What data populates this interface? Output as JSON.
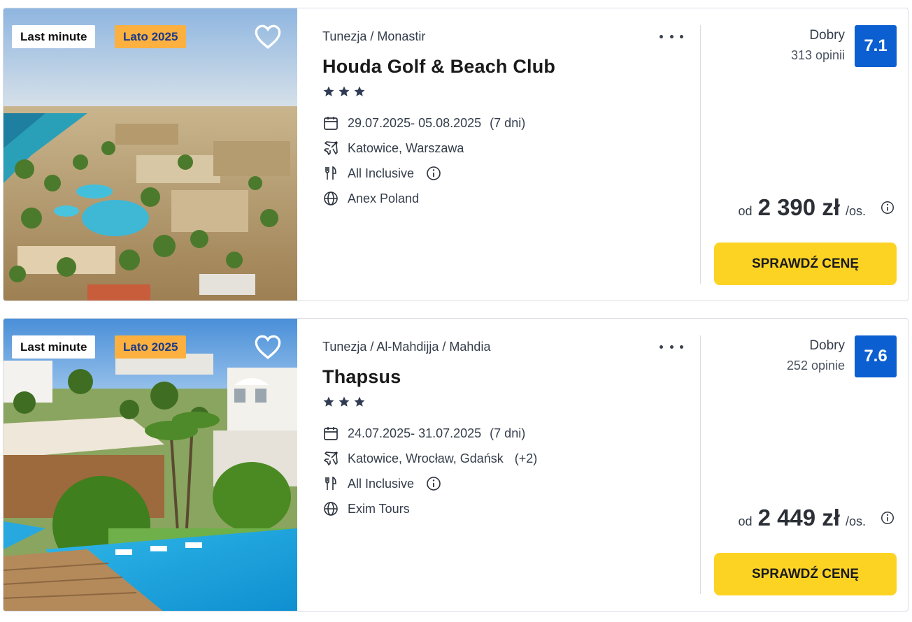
{
  "offers": [
    {
      "badges": {
        "last_minute": "Last minute",
        "season": "Lato 2025"
      },
      "location": "Tunezja / Monastir",
      "name": "Houda Golf & Beach Club",
      "stars": 3,
      "dates": "29.07.2025- 05.08.2025",
      "duration": "(7 dni)",
      "departures": "Katowice, Warszawa",
      "departures_extra": "",
      "board": "All Inclusive",
      "operator": "Anex Poland",
      "rating_label": "Dobry",
      "rating_count": "313 opinii",
      "rating_score": "7.1",
      "price_from": "od",
      "price": "2 390 zł",
      "price_unit": "/os.",
      "cta": "SPRAWDŹ CENĘ"
    },
    {
      "badges": {
        "last_minute": "Last minute",
        "season": "Lato 2025"
      },
      "location": "Tunezja / Al-Mahdijja / Mahdia",
      "name": "Thapsus",
      "stars": 3,
      "dates": "24.07.2025- 31.07.2025",
      "duration": "(7 dni)",
      "departures": "Katowice, Wrocław, Gdańsk",
      "departures_extra": "(+2)",
      "board": "All Inclusive",
      "operator": "Exim Tours",
      "rating_label": "Dobry",
      "rating_count": "252 opinie",
      "rating_score": "7.6",
      "price_from": "od",
      "price": "2 449 zł",
      "price_unit": "/os.",
      "cta": "SPRAWDŹ CENĘ"
    }
  ],
  "icons": {
    "favorite": "heart-outline-icon",
    "more": "more-horizontal-icon",
    "star": "star-icon",
    "date": "calendar-icon",
    "flight": "plane-icon",
    "board": "cutlery-icon",
    "operator": "globe-icon",
    "info": "info-icon"
  },
  "colors": {
    "accent_button": "#fdd323",
    "rating_badge": "#0b5fd0",
    "season_badge": "#fbb040",
    "star": "#2f3b52"
  }
}
